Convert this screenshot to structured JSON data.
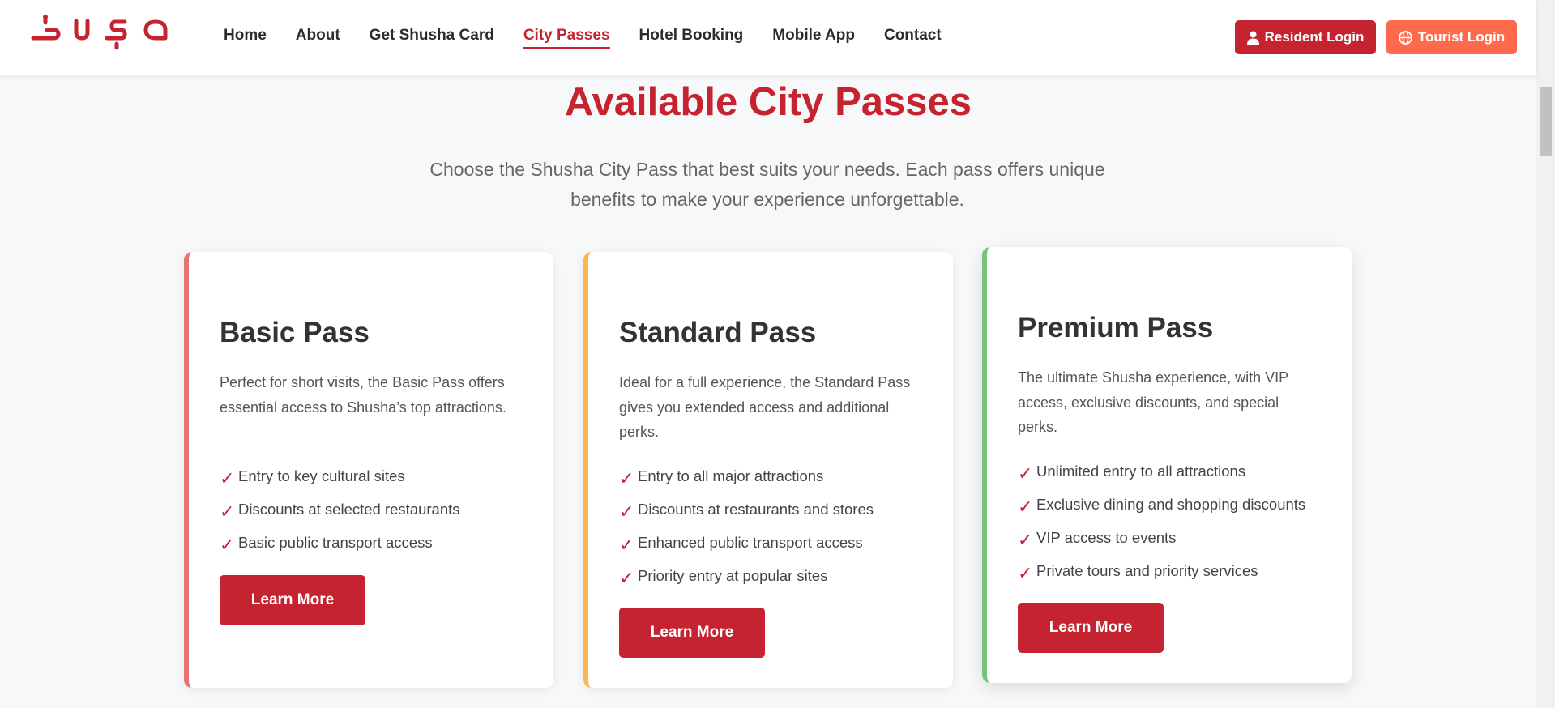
{
  "header": {
    "logo_text": "Şuşa",
    "nav": [
      {
        "label": "Home",
        "active": false
      },
      {
        "label": "About",
        "active": false
      },
      {
        "label": "Get Shusha Card",
        "active": false
      },
      {
        "label": "City Passes",
        "active": true
      },
      {
        "label": "Hotel Booking",
        "active": false
      },
      {
        "label": "Mobile App",
        "active": false
      },
      {
        "label": "Contact",
        "active": false
      }
    ],
    "resident_login": "Resident Login",
    "tourist_login": "Tourist Login"
  },
  "main": {
    "title": "Available City Passes",
    "subtitle_line1": "Choose the Shusha City Pass that best suits your needs. Each pass offers unique",
    "subtitle_line2": "benefits to make your experience unforgettable."
  },
  "cards": [
    {
      "title": "Basic Pass",
      "description": "Perfect for short visits, the Basic Pass offers essential access to Shusha’s top attractions.",
      "features": [
        "Entry to key cultural sites",
        "Discounts at selected restaurants",
        "Basic public transport access"
      ],
      "button": "Learn More",
      "accent": "#e57373"
    },
    {
      "title": "Standard Pass",
      "description": "Ideal for a full experience, the Standard Pass gives you extended access and additional perks.",
      "features": [
        "Entry to all major attractions",
        "Discounts at restaurants and stores",
        "Enhanced public transport access",
        "Priority entry at popular sites"
      ],
      "button": "Learn More",
      "accent": "#f9b84c"
    },
    {
      "title": "Premium Pass",
      "description": "The ultimate Shusha experience, with VIP access, exclusive discounts, and special perks.",
      "features": [
        "Unlimited entry to all attractions",
        "Exclusive dining and shopping discounts",
        "VIP access to events",
        "Private tours and priority services"
      ],
      "button": "Learn More",
      "accent": "#79c27a"
    }
  ],
  "colors": {
    "brand": "#c5232f",
    "tourist": "#ff6a4d"
  },
  "check_glyph": "✓"
}
